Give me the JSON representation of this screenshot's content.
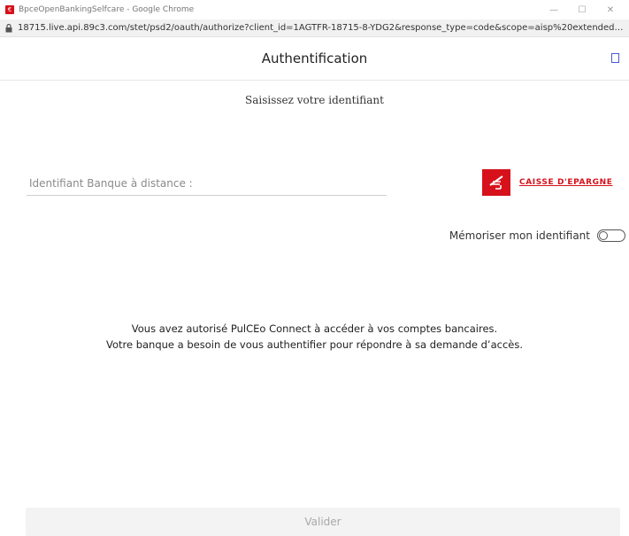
{
  "window": {
    "title": "BpceOpenBankingSelfcare - Google Chrome",
    "url": "18715.live.api.89c3.com/stet/psd2/oauth/authorize?client_id=1AGTFR-18715-8-YDG2&response_type=code&scope=aisp%20extended_t..."
  },
  "header": {
    "title": "Authentification"
  },
  "form": {
    "subtitle": "Saisissez votre identifiant",
    "identifier_placeholder": "Identifiant Banque à distance :",
    "identifier_value": "",
    "remember_label": "Mémoriser mon identifiant",
    "remember_checked": false
  },
  "bank": {
    "name": "CAISSE D'EPARGNE",
    "brand_color": "#d6111b"
  },
  "message": {
    "line1": "Vous avez autorisé PulCEo Connect à accéder à vos comptes bancaires.",
    "line2": "Votre banque a besoin de vous authentifier pour répondre à sa demande d’accès."
  },
  "actions": {
    "submit_label": "Valider"
  },
  "icons": {
    "app": "caisse-epargne-favicon",
    "lock": "lock-icon",
    "menu": "square-icon"
  }
}
